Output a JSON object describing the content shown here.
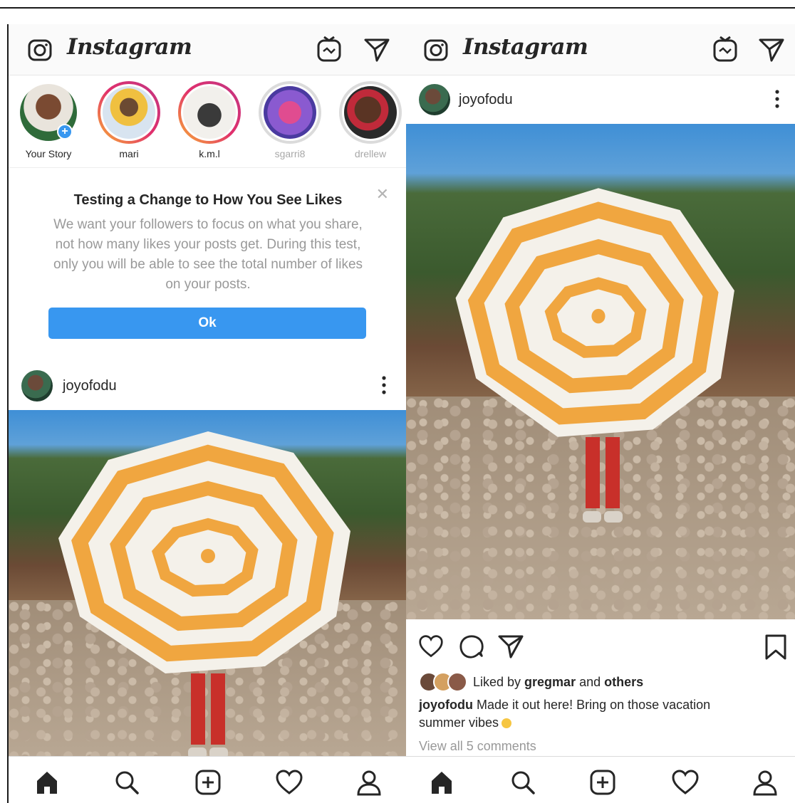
{
  "app": {
    "title": "Instagram"
  },
  "icons": [
    "camera-icon",
    "igtv-icon",
    "direct-message-icon",
    "close-icon",
    "more-options-icon",
    "heart-icon",
    "comment-icon",
    "share-icon",
    "bookmark-icon",
    "home-icon",
    "search-icon",
    "add-post-icon",
    "activity-heart-icon",
    "profile-icon"
  ],
  "colors": {
    "accent": "#3897f0",
    "text": "#262626",
    "muted": "#999999"
  },
  "left": {
    "stories": [
      {
        "name": "Your Story",
        "seen": false,
        "own": true
      },
      {
        "name": "mari",
        "seen": false
      },
      {
        "name": "k.m.l",
        "seen": false
      },
      {
        "name": "sgarri8",
        "seen": true
      },
      {
        "name": "drellew",
        "seen": true
      }
    ],
    "notice": {
      "title": "Testing a Change to How You See Likes",
      "body": "We want your followers to focus on what you share, not how many likes your posts get. During this test, only you will be able to see the total number of likes on your posts.",
      "button": "Ok"
    },
    "post": {
      "username": "joyofodu"
    }
  },
  "right": {
    "post": {
      "username": "joyofodu",
      "liked_prefix": "Liked by ",
      "liked_user": "gregmar",
      "liked_and": " and ",
      "liked_others": "others",
      "caption_user": "joyofodu",
      "caption_text": " Made it out here! Bring on those vacation summer vibes",
      "view_comments": "View all 5 comments"
    }
  }
}
